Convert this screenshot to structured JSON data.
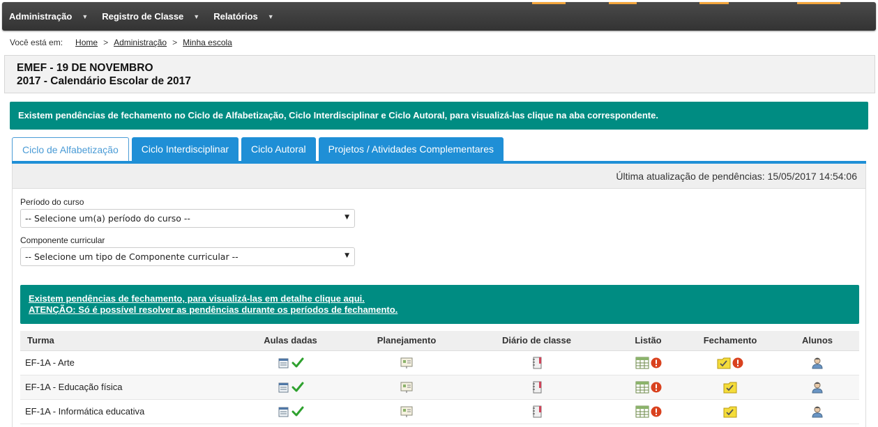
{
  "nav": {
    "items": [
      {
        "label": "Administração"
      },
      {
        "label": "Registro de Classe"
      },
      {
        "label": "Relatórios"
      }
    ],
    "accent_color": "#f3a53b"
  },
  "breadcrumb": {
    "prefix": "Você está em:",
    "links": [
      "Home",
      "Administração",
      "Minha escola"
    ],
    "separator": ">"
  },
  "school": {
    "name": "EMEF - 19 DE NOVEMBRO",
    "calendar": "2017 - Calendário Escolar de 2017"
  },
  "alert_top": "Existem pendências de fechamento no Ciclo de Alfabetização, Ciclo Interdisciplinar e Ciclo Autoral, para visualizá-las clique na aba correspondente.",
  "tabs": [
    {
      "label": "Ciclo de Alfabetização",
      "active": true
    },
    {
      "label": "Ciclo Interdisciplinar",
      "active": false
    },
    {
      "label": "Ciclo Autoral",
      "active": false
    },
    {
      "label": "Projetos / Atividades Complementares",
      "active": false
    }
  ],
  "last_update": "Última atualização de pendências: 15/05/2017 14:54:06",
  "filters": {
    "periodo_label": "Período do curso",
    "periodo_value": "-- Selecione um(a) período do curso --",
    "componente_label": "Componente curricular",
    "componente_value": "-- Selecione um tipo de Componente curricular --"
  },
  "alert_mid": {
    "line1": "Existem pendências de fechamento, para visualizá-las em detalhe clique aqui.",
    "line2": "ATENÇÃO: Só é possível resolver as pendências durante os períodos de fechamento."
  },
  "table": {
    "headers": [
      "Turma",
      "Aulas dadas",
      "Planejamento",
      "Diário de classe",
      "Listão",
      "Fechamento",
      "Alunos"
    ],
    "rows": [
      {
        "turma": "EF-1A - Arte",
        "listao_alert": true,
        "fechamento_alert": true
      },
      {
        "turma": "EF-1A - Educação física",
        "listao_alert": true,
        "fechamento_alert": false
      },
      {
        "turma": "EF-1A - Informática educativa",
        "listao_alert": true,
        "fechamento_alert": false
      }
    ]
  },
  "colors": {
    "teal": "#008c82",
    "tab_blue": "#1f8fd6",
    "alert_red": "#d9421f",
    "check_green": "#2ea12e"
  }
}
